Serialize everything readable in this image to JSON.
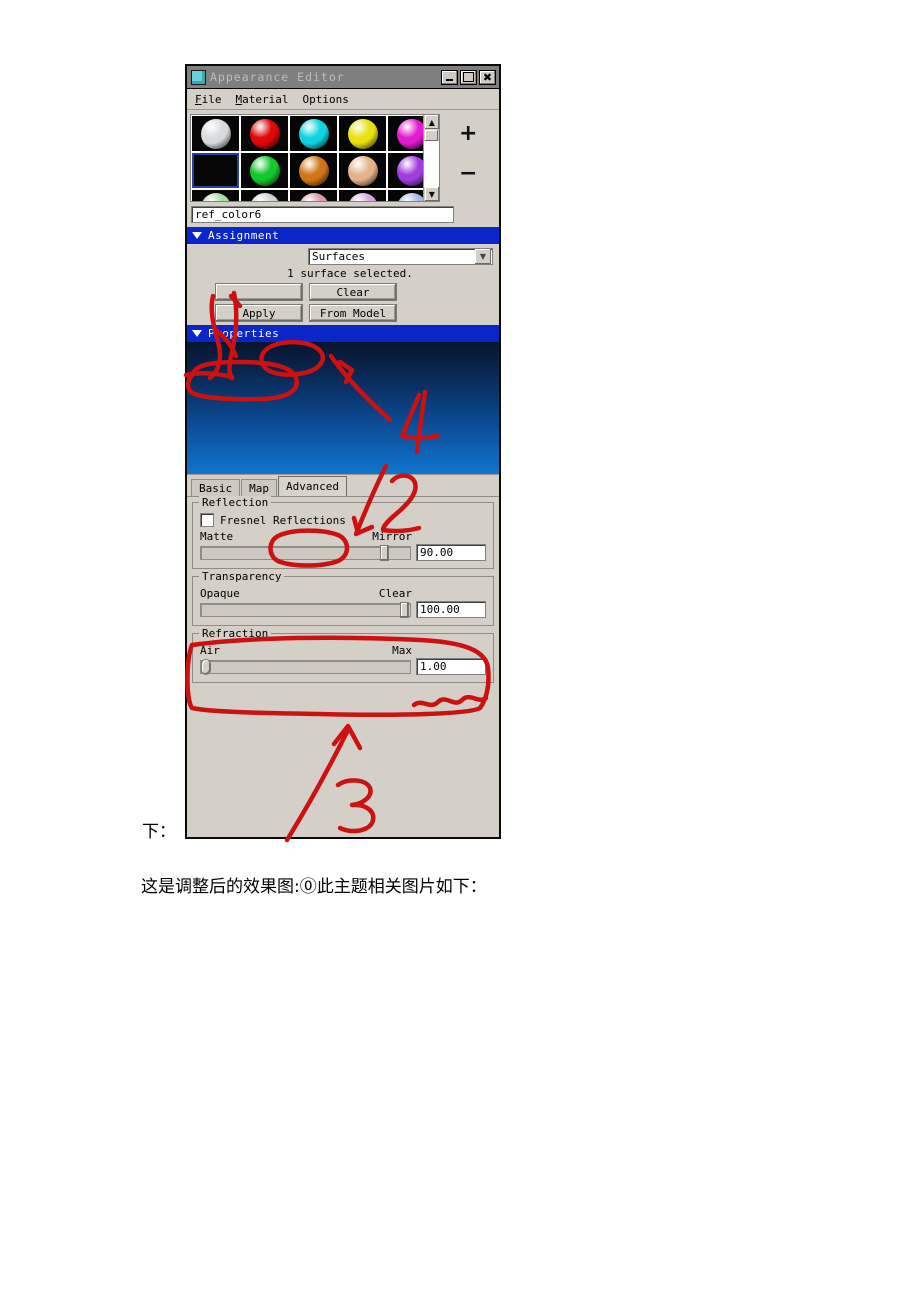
{
  "window": {
    "title": "Appearance Editor",
    "icon": "appearance-editor-icon",
    "buttons": {
      "minimize": "_",
      "maximize": "□",
      "close": "✕"
    }
  },
  "menubar": {
    "items": [
      {
        "label": "File",
        "mnemonic": "F"
      },
      {
        "label": "Material",
        "mnemonic": "M"
      },
      {
        "label": "Options",
        "mnemonic": "O"
      }
    ]
  },
  "browser": {
    "zoom_in_label": "+",
    "zoom_out_label": "−",
    "scroll_up_icon": "chevron-up-icon",
    "scroll_down_icon": "chevron-down-icon",
    "swatches": [
      {
        "color": "#d8dade",
        "selected": false
      },
      {
        "color": "#e00808",
        "selected": false
      },
      {
        "color": "#0fd3e0",
        "selected": false
      },
      {
        "color": "#e8e010",
        "selected": false
      },
      {
        "color": "#e21ad0",
        "selected": false
      },
      {
        "color": "#000000",
        "selected": true
      },
      {
        "color": "#13c82a",
        "selected": false
      },
      {
        "color": "#d07618",
        "selected": false
      },
      {
        "color": "#e4b38c",
        "selected": false
      },
      {
        "color": "#a23cdc",
        "selected": false
      },
      {
        "color": "#a6dca6",
        "selected": false
      },
      {
        "color": "#d2d2d2",
        "selected": false
      },
      {
        "color": "#e09aa8",
        "selected": false
      },
      {
        "color": "#d8a6e0",
        "selected": false
      },
      {
        "color": "#a8b6e4",
        "selected": false
      }
    ]
  },
  "material_name": {
    "value": "ref_color6"
  },
  "assignment": {
    "header": "Assignment",
    "target_select": {
      "value": "Surfaces",
      "arrow_icon": "chevron-down-icon"
    },
    "status": "1 surface selected.",
    "buttons": {
      "select": "",
      "clear": "Clear",
      "apply": "Apply",
      "from_model": "From Model"
    }
  },
  "properties": {
    "header": "Properties",
    "preview": {
      "gradient_top": "#06152e",
      "gradient_bottom": "#0f76cd"
    },
    "tabs": [
      {
        "label": "Basic",
        "active": false
      },
      {
        "label": "Map",
        "active": false
      },
      {
        "label": "Advanced",
        "active": true
      }
    ],
    "reflection": {
      "group_label": "Reflection",
      "fresnel_label": "Fresnel Reflections",
      "fresnel_checked": false,
      "left_label": "Matte",
      "right_label": "Mirror",
      "value": "90.00",
      "percent": 90
    },
    "transparency": {
      "group_label": "Transparency",
      "left_label": "Opaque",
      "right_label": "Clear",
      "value": "100.00",
      "percent": 100
    },
    "refraction": {
      "group_label": "Refraction",
      "left_label": "Air",
      "right_label": "Max",
      "value": "1.00",
      "percent": 0
    }
  },
  "annotations": {
    "marks": [
      "1",
      "2",
      "3",
      "4"
    ],
    "color": "#cc1111"
  },
  "page_text": {
    "line1": "下：",
    "line2": "这是调整后的效果图:⓪此主题相关图片如下："
  }
}
